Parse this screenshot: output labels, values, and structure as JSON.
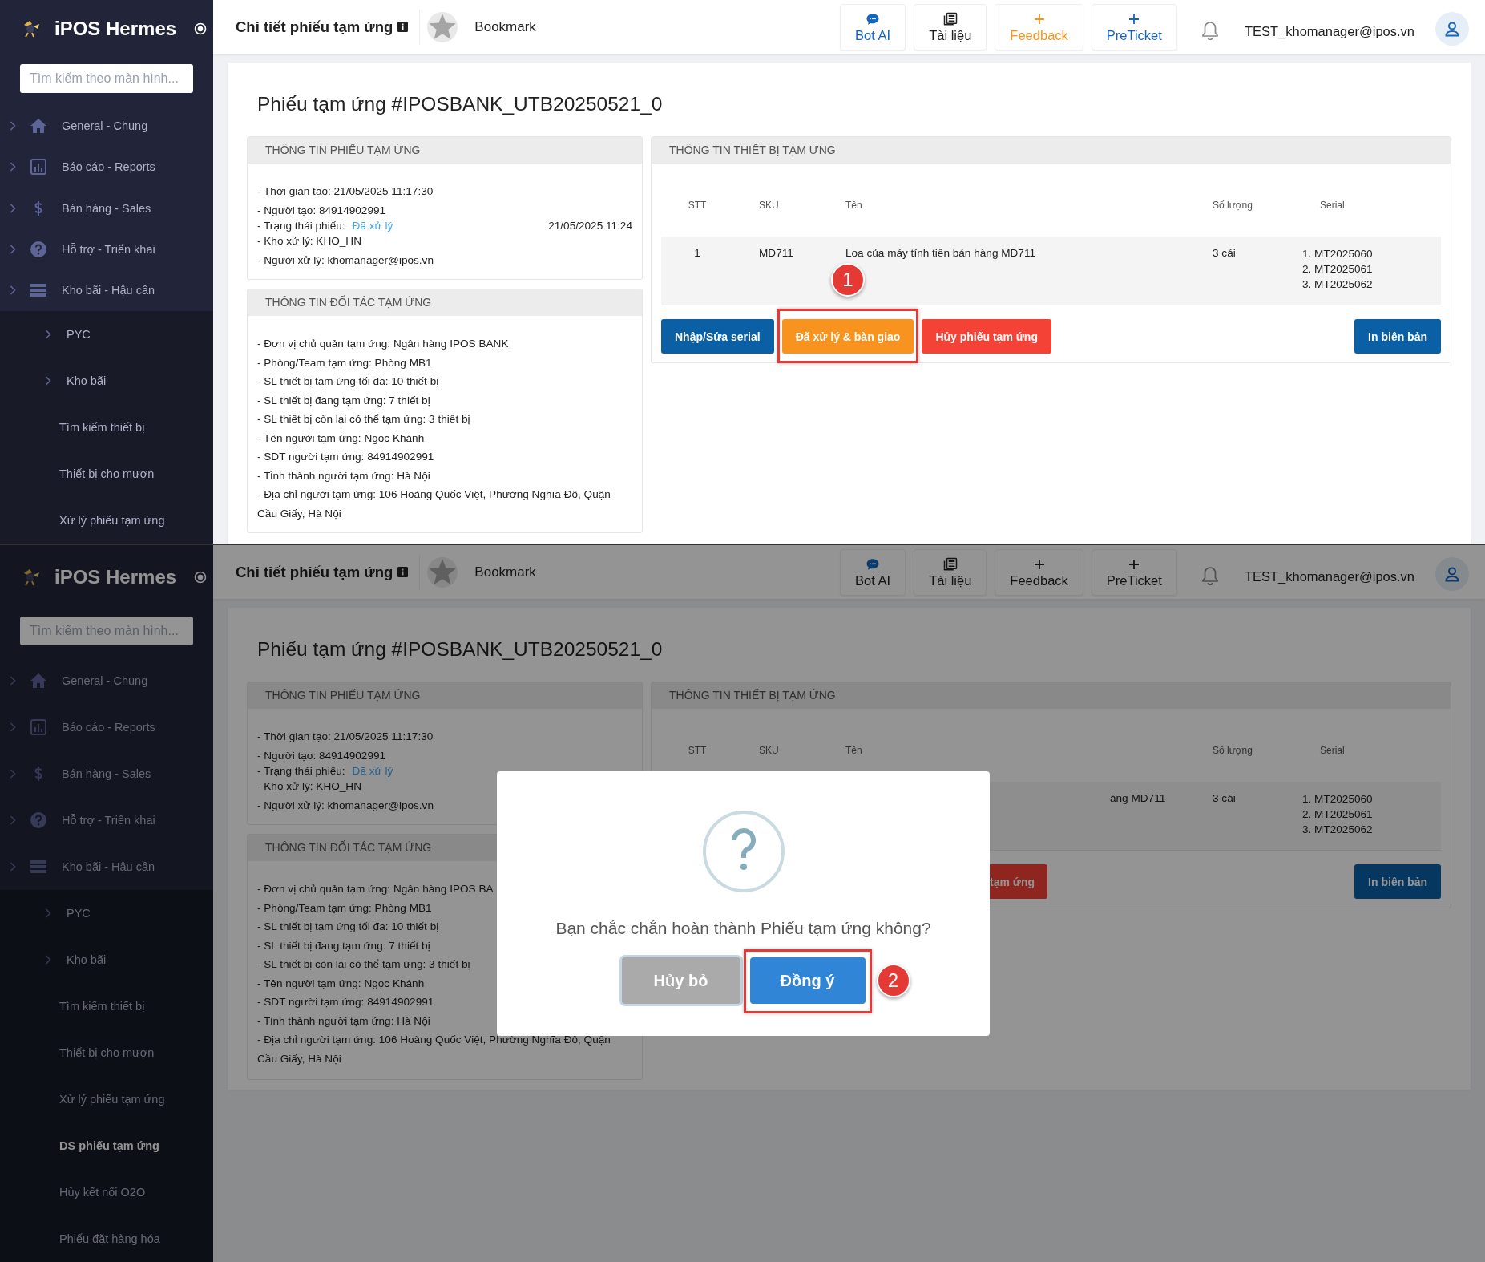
{
  "screens": [
    {
      "sidebar": {
        "brand": "iPOS Hermes",
        "search": {
          "placeholder": "Tìm kiếm theo màn hình..."
        },
        "items": [
          {
            "label": "General - Chung"
          },
          {
            "label": "Báo cáo - Reports"
          },
          {
            "label": "Bán hàng - Sales"
          },
          {
            "label": "Hỗ trợ - Triển khai"
          },
          {
            "label": "Kho bãi - Hậu cần",
            "children": [
              {
                "label": "PYC",
                "kind": "group",
                "selected": false
              },
              {
                "label": "Kho bãi",
                "kind": "group",
                "selected": false
              },
              {
                "label": "Tìm kiếm thiết bị",
                "kind": "link",
                "selected": false
              },
              {
                "label": "Thiết bị cho mượn",
                "kind": "link",
                "selected": false
              },
              {
                "label": "Xử lý phiếu tạm ứng",
                "kind": "link",
                "selected": false
              }
            ]
          }
        ]
      },
      "header": {
        "title": "Chi tiết phiếu tạm ứng",
        "bookmark": "Bookmark",
        "actions": [
          {
            "label": "Bot AI",
            "color": "#1565c0"
          },
          {
            "label": "Tài liệu",
            "color": "#222222"
          },
          {
            "label": "Feedback",
            "color": "#f7931e"
          },
          {
            "label": "PreTicket",
            "color": "#1565c0"
          }
        ],
        "user": "TEST_khomanager@ipos.vn"
      },
      "page": {
        "title": "Phiếu tạm ứng #IPOSBANK_UTB20250521_0",
        "ticket": {
          "heading": "THÔNG TIN PHIẾU TẠM ỨNG",
          "lines": [
            {
              "text": "- Thời gian tạo: 21/05/2025 11:17:30"
            },
            {
              "text": "- Người tạo: 84914902991"
            },
            {
              "text": "- Trạng thái phiếu:",
              "status": "Đã xử lý",
              "date": "21/05/2025 11:24"
            },
            {
              "text": "- Kho xử lý: KHO_HN"
            },
            {
              "text": "- Người xử lý: khomanager@ipos.vn"
            }
          ]
        },
        "partner": {
          "heading": "THÔNG TIN ĐỐI TÁC TẠM ỨNG",
          "lines": [
            {
              "text": "- Đơn vị chủ quản tạm ứng: Ngân hàng IPOS BANK"
            },
            {
              "text": "- Phòng/Team tạm ứng: Phòng MB1"
            },
            {
              "text": "- SL thiết bị tạm ứng tối đa: 10 thiết bị"
            },
            {
              "text": "- SL thiết bị đang tạm ứng: 7 thiết bị"
            },
            {
              "text": "- SL thiết bị còn lại có thể tạm ứng: 3 thiết bị"
            },
            {
              "text": "- Tên người tạm ứng: Ngọc Khánh"
            },
            {
              "text": "- SDT người tạm ứng: 84914902991"
            },
            {
              "text": "- Tỉnh thành người tạm ứng: Hà Nội"
            },
            {
              "text": "- Địa chỉ người tạm ứng: 106 Hoàng Quốc Việt, Phường Nghĩa Đô, Quận Cầu Giấy, Hà Nội"
            }
          ]
        },
        "devices": {
          "heading": "THÔNG TIN THIẾT BỊ TẠM ỨNG",
          "columns": [
            "STT",
            "SKU",
            "Tên",
            "Số lượng",
            "Serial"
          ],
          "rows": [
            {
              "stt": "1",
              "sku": "MD711",
              "name": "Loa của máy tính tiền bán hàng MD711",
              "quantity": "3 cái",
              "serials": [
                "1. MT2025060",
                "2. MT2025061",
                "3. MT2025062"
              ]
            }
          ],
          "buttons": [
            {
              "label": "Nhập/Sửa serial",
              "kind": "primary"
            },
            {
              "label": "Đã xử lý & bàn giao",
              "kind": "warning",
              "callout": "1"
            },
            {
              "label": "Hủy phiếu tạm ứng",
              "kind": "danger"
            },
            {
              "label": "In biên bản",
              "kind": "primary"
            }
          ]
        }
      }
    },
    {
      "sidebar": {
        "brand": "iPOS Hermes",
        "search": {
          "placeholder": "Tìm kiếm theo màn hình..."
        },
        "items": [
          {
            "label": "General - Chung"
          },
          {
            "label": "Báo cáo - Reports"
          },
          {
            "label": "Bán hàng - Sales"
          },
          {
            "label": "Hỗ trợ - Triển khai"
          },
          {
            "label": "Kho bãi - Hậu cần",
            "children": [
              {
                "label": "PYC",
                "kind": "group",
                "selected": false
              },
              {
                "label": "Kho bãi",
                "kind": "group",
                "selected": false
              },
              {
                "label": "Tìm kiếm thiết bị",
                "kind": "link",
                "selected": false
              },
              {
                "label": "Thiết bị cho mượn",
                "kind": "link",
                "selected": false
              },
              {
                "label": "Xử lý phiếu tạm ứng",
                "kind": "link",
                "selected": false
              },
              {
                "label": "DS phiếu tạm ứng",
                "kind": "link",
                "selected": true
              },
              {
                "label": "Hủy kết nối O2O",
                "kind": "link",
                "selected": false
              },
              {
                "label": "Phiếu đặt hàng hóa",
                "kind": "link",
                "selected": false
              }
            ]
          }
        ]
      },
      "header": {
        "title": "Chi tiết phiếu tạm ứng",
        "bookmark": "Bookmark",
        "actions": [
          {
            "label": "Bot AI"
          },
          {
            "label": "Tài liệu"
          },
          {
            "label": "Feedback"
          },
          {
            "label": "PreTicket"
          }
        ],
        "user": "TEST_khomanager@ipos.vn"
      },
      "page": {
        "title": "Phiếu tạm ứng #IPOSBANK_UTB20250521_0",
        "ticket": {
          "heading": "THÔNG TIN PHIẾU TẠM ỨNG",
          "lines": [
            {
              "text": "- Thời gian tạo: 21/05/2025 11:17:30"
            },
            {
              "text": "- Người tạo: 84914902991"
            },
            {
              "text": "- Trạng thái phiếu:",
              "status": "Đã xử lý"
            },
            {
              "text": "- Kho xử lý: KHO_HN"
            },
            {
              "text": "- Người xử lý: khomanager@ipos.vn"
            }
          ]
        },
        "partner": {
          "heading": "THÔNG TIN ĐỐI TÁC TẠM ỨNG",
          "lines": [
            {
              "text": "- Đơn vị chủ quản tạm ứng: Ngân hàng IPOS BA"
            },
            {
              "text": "- Phòng/Team tạm ứng: Phòng MB1"
            },
            {
              "text": "- SL thiết bị tạm ứng tối đa: 10 thiết bị"
            },
            {
              "text": "- SL thiết bị đang tạm ứng: 7 thiết bị"
            },
            {
              "text": "- SL thiết bị còn lại có thể tạm ứng: 3 thiết bị"
            },
            {
              "text": "- Tên người tạm ứng: Ngọc Khánh"
            },
            {
              "text": "- SDT người tạm ứng: 84914902991"
            },
            {
              "text": "- Tỉnh thành người tạm ứng: Hà Nội"
            },
            {
              "text": "- Địa chỉ người tạm ứng: 106 Hoàng Quốc Việt, Phường Nghĩa Đô, Quận Cầu Giấy, Hà Nội"
            }
          ]
        },
        "devices": {
          "heading": "THÔNG TIN THIẾT BỊ TẠM ỨNG",
          "columns": [
            "STT",
            "SKU",
            "Tên",
            "Số lượng",
            "Serial"
          ],
          "rows": [
            {
              "name": "àng MD711",
              "quantity": "3 cái",
              "serials": [
                "1. MT2025060",
                "2. MT2025061",
                "3. MT2025062"
              ]
            }
          ],
          "buttons": [
            {
              "label": "tạm ứng",
              "kind": "danger"
            },
            {
              "label": "In biên bản",
              "kind": "primary"
            }
          ]
        }
      },
      "dialog": {
        "message": "Bạn chắc chắn hoàn thành Phiếu tạm ứng không?",
        "buttons": [
          {
            "label": "Hủy bỏ",
            "kind": "cancel"
          },
          {
            "label": "Đồng ý",
            "kind": "confirm",
            "callout": "2"
          }
        ]
      }
    }
  ]
}
